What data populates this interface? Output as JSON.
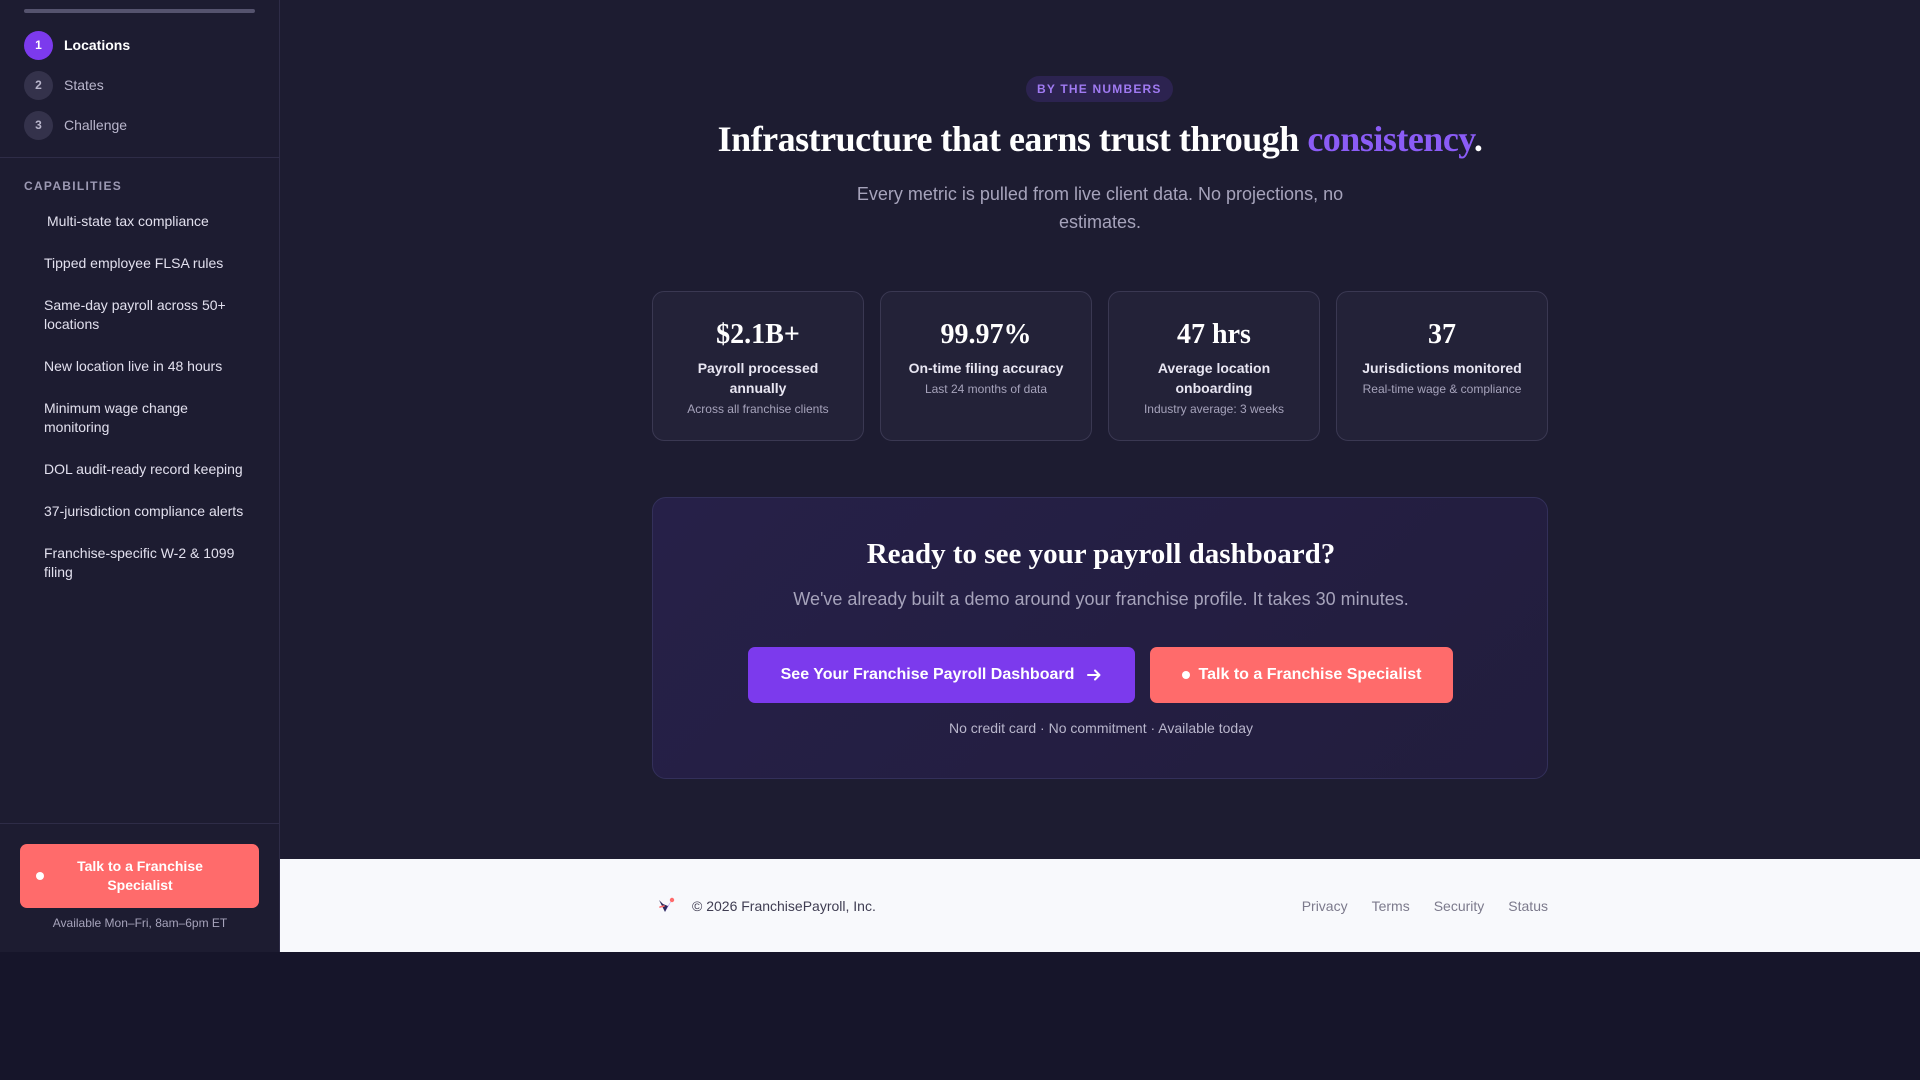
{
  "sidebar": {
    "progress_fraction": 1,
    "steps": [
      {
        "num": "1",
        "label": "Locations",
        "active": true
      },
      {
        "num": "2",
        "label": "States",
        "active": false
      },
      {
        "num": "3",
        "label": "Challenge",
        "active": false
      }
    ],
    "capabilities_title": "CAPABILITIES",
    "capabilities": [
      "Multi-state tax compliance",
      "Tipped employee FLSA rules",
      "Same-day payroll across 50+ locations",
      "New location live in 48 hours",
      "Minimum wage change monitoring",
      "DOL audit-ready record keeping",
      "37-jurisdiction compliance alerts",
      "Franchise-specific W-2 & 1099 filing"
    ],
    "cta_label": "Talk to a Franchise Specialist",
    "availability": "Available Mon–Fri, 8am–6pm ET"
  },
  "hero": {
    "badge": "BY THE NUMBERS",
    "title_pre": "Infrastructure that earns trust through ",
    "title_accent": "consistency",
    "title_post": ".",
    "subtitle": "Every metric is pulled from live client data. No projections, no estimates."
  },
  "stats": [
    {
      "value": "$2.1B+",
      "label": "Payroll processed annually",
      "note": "Across all franchise clients"
    },
    {
      "value": "99.97%",
      "label": "On-time filing accuracy",
      "note": "Last 24 months of data"
    },
    {
      "value": "47 hrs",
      "label": "Average location onboarding",
      "note": "Industry average: 3 weeks"
    },
    {
      "value": "37",
      "label": "Jurisdictions monitored",
      "note": "Real-time wage & compliance"
    }
  ],
  "cta": {
    "title": "Ready to see your payroll dashboard?",
    "subtitle": "We've already built a demo around your franchise profile. It takes 30 minutes.",
    "primary_label": "See Your Franchise Payroll Dashboard",
    "secondary_label": "Talk to a Franchise Specialist",
    "fine_print": "No credit card · No commitment · Available today"
  },
  "footer": {
    "copyright": "© 2026 FranchisePayroll, Inc.",
    "links": [
      "Privacy",
      "Terms",
      "Security",
      "Status"
    ]
  },
  "colors": {
    "accent": "#7c3aed",
    "accent_text": "#8b5cf6",
    "coral": "#ff6b6b",
    "background": "#1d1c31"
  },
  "icons": {
    "primary_arrow": "arrow-right-icon",
    "logo": "franchise-payroll-logo-icon"
  }
}
